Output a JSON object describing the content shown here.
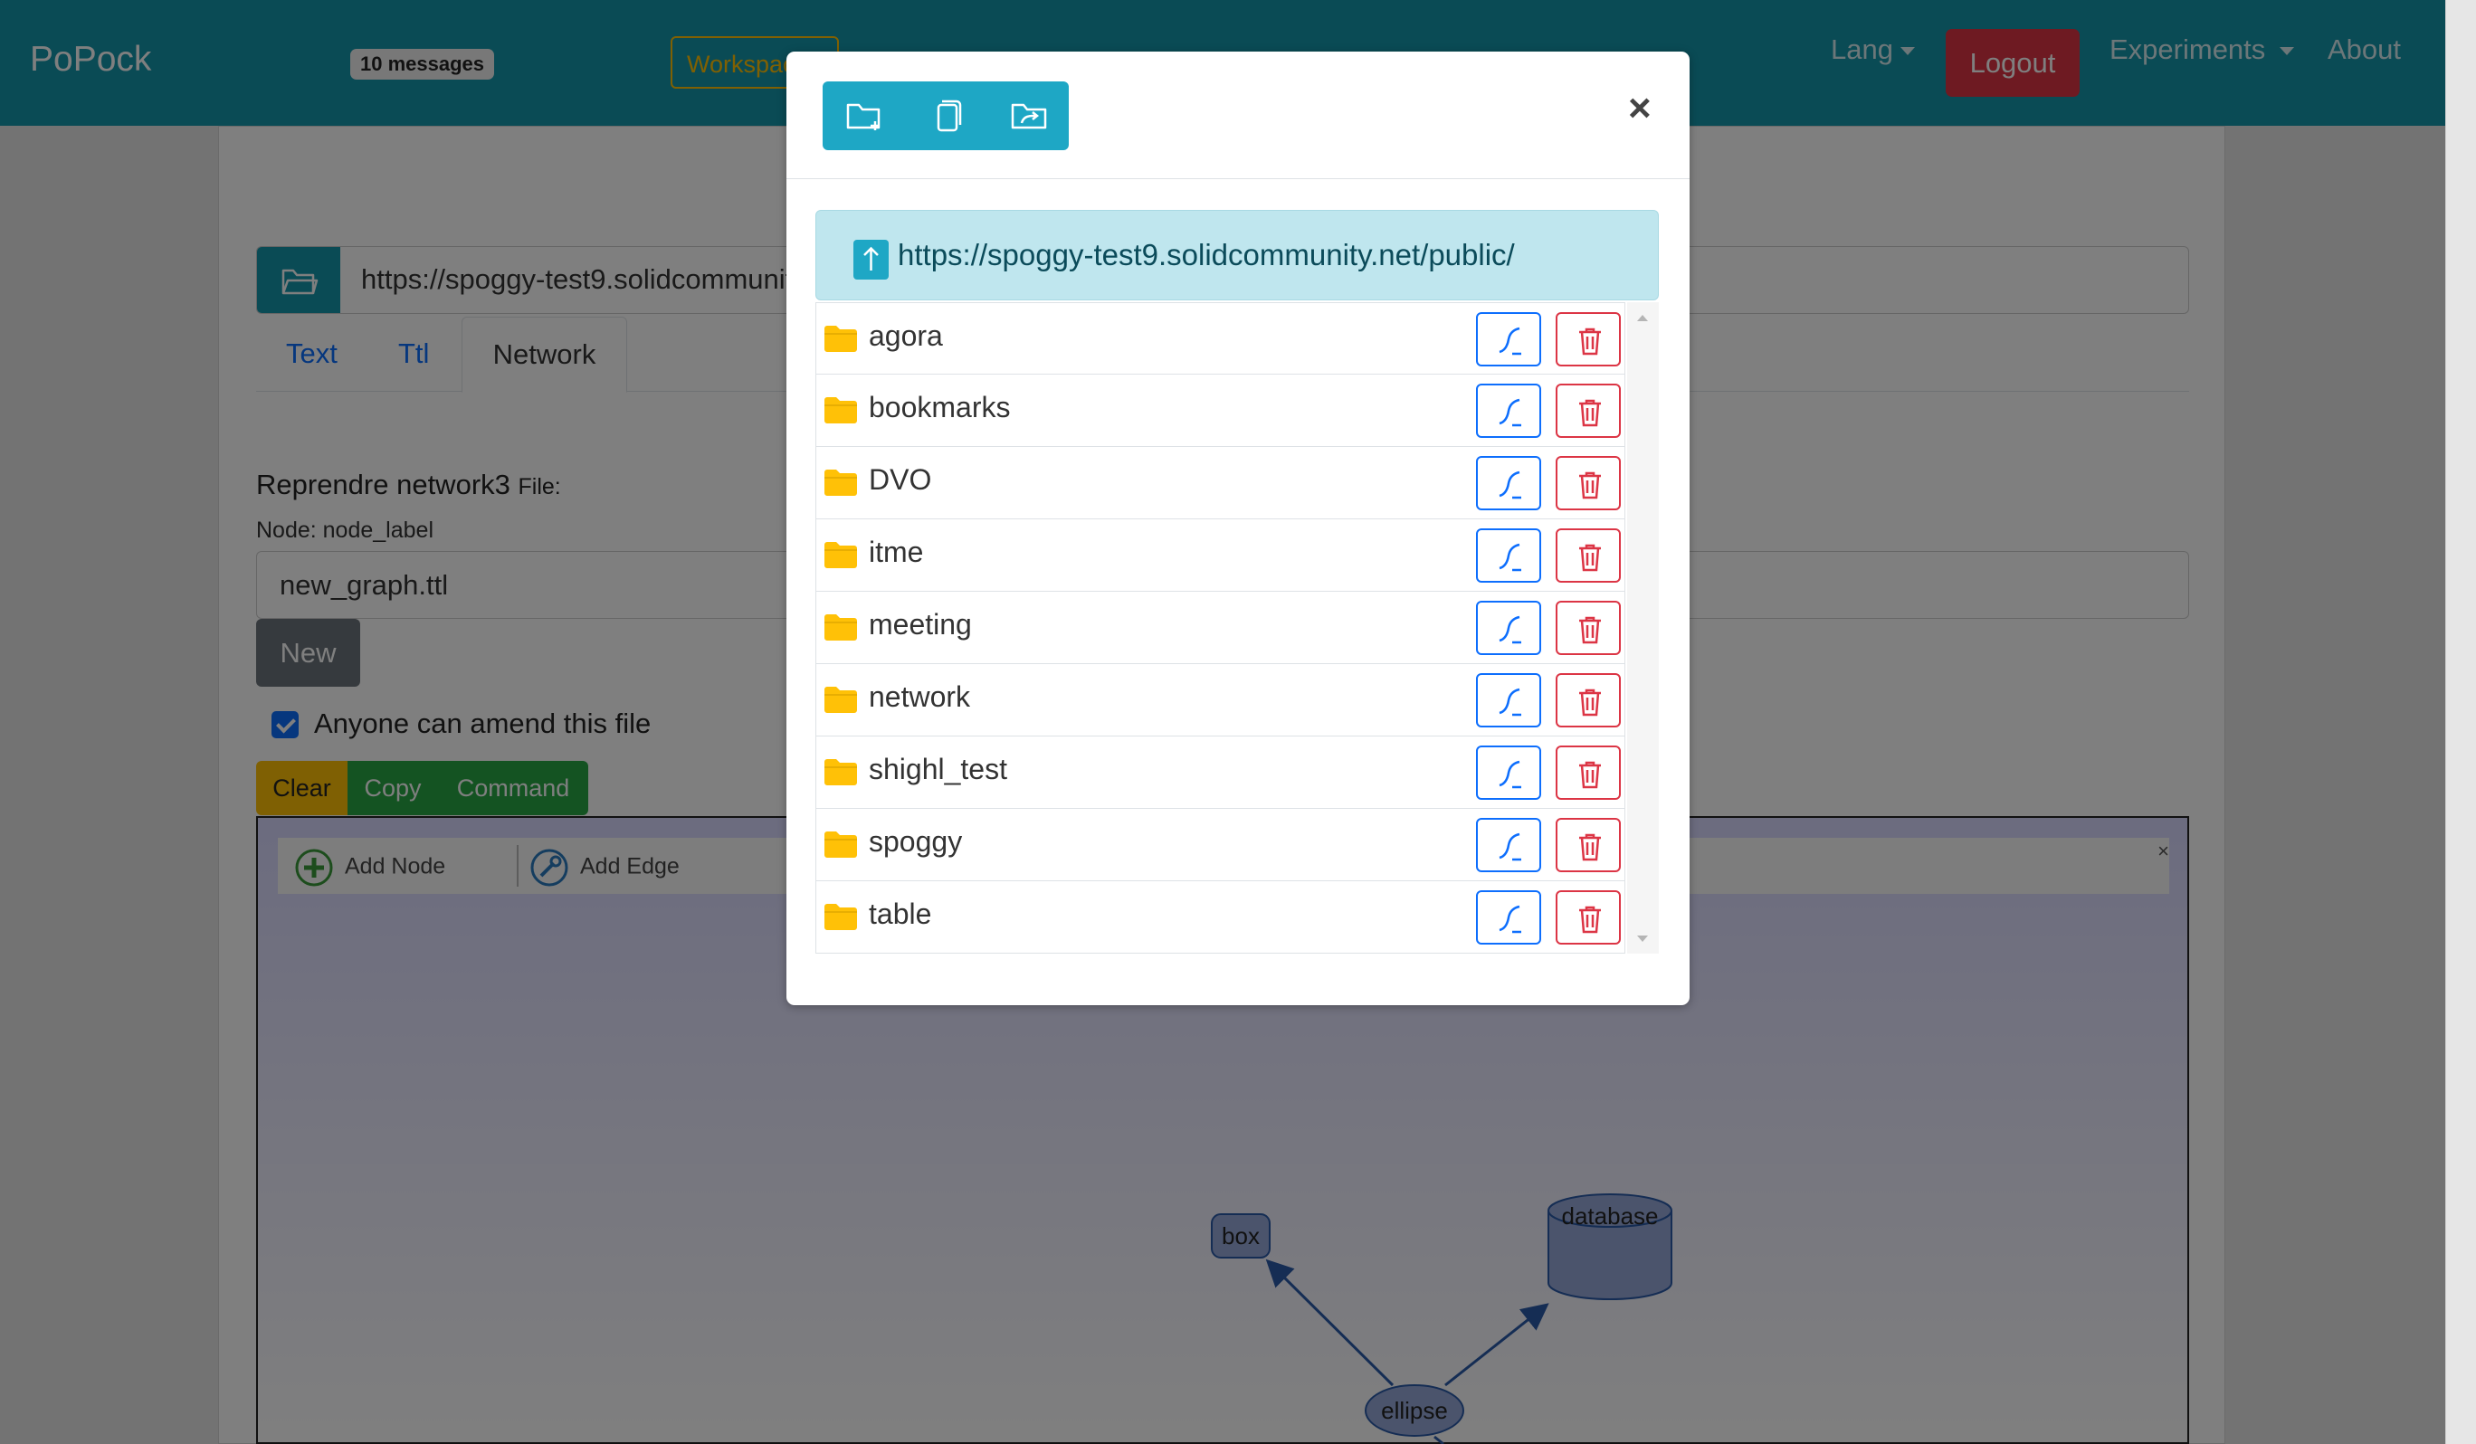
{
  "navbar": {
    "brand": "PoPock",
    "messages_badge": "10 messages",
    "workspace_label": "Workspace",
    "lang_label": "Lang",
    "logout_label": "Logout",
    "experiments_label": "Experiments",
    "about_label": "About"
  },
  "page": {
    "url_value": "https://spoggy-test9.solidcommunity.net/public/",
    "tabs": [
      {
        "label": "Text"
      },
      {
        "label": "Ttl"
      },
      {
        "label": "Network"
      }
    ],
    "title": "Reprendre network3",
    "file_label": "File:",
    "node_label": "Node: node_label",
    "filename_value": "new_graph.ttl",
    "new_button": "New",
    "amend_checkbox_label": "Anyone can amend this file",
    "clear_button": "Clear",
    "copy_button": "Copy",
    "command_button": "Command"
  },
  "network": {
    "add_node_label": "Add Node",
    "add_edge_label": "Add Edge",
    "close_label": "×",
    "nodes": [
      {
        "label": "box",
        "shape": "box"
      },
      {
        "label": "database",
        "shape": "database"
      },
      {
        "label": "ellipse",
        "shape": "ellipse"
      }
    ],
    "node_color": "#97a9d8",
    "edge_color": "#2b5aa8"
  },
  "modal": {
    "close_label": "×",
    "path": "https://spoggy-test9.solidcommunity.net/public/",
    "folders": [
      {
        "name": "agora"
      },
      {
        "name": "bookmarks"
      },
      {
        "name": "DVO"
      },
      {
        "name": "itme"
      },
      {
        "name": "meeting"
      },
      {
        "name": "network"
      },
      {
        "name": "shighl_test"
      },
      {
        "name": "spoggy"
      },
      {
        "name": "table"
      }
    ],
    "toolbar_icons": [
      "folder-plus-icon",
      "copy-icon",
      "folder-move-icon"
    ]
  },
  "colors": {
    "primary": "#1596aa",
    "danger": "#dc3545",
    "warning": "#ffc107",
    "success": "#28a745",
    "link": "#0d6efd"
  }
}
